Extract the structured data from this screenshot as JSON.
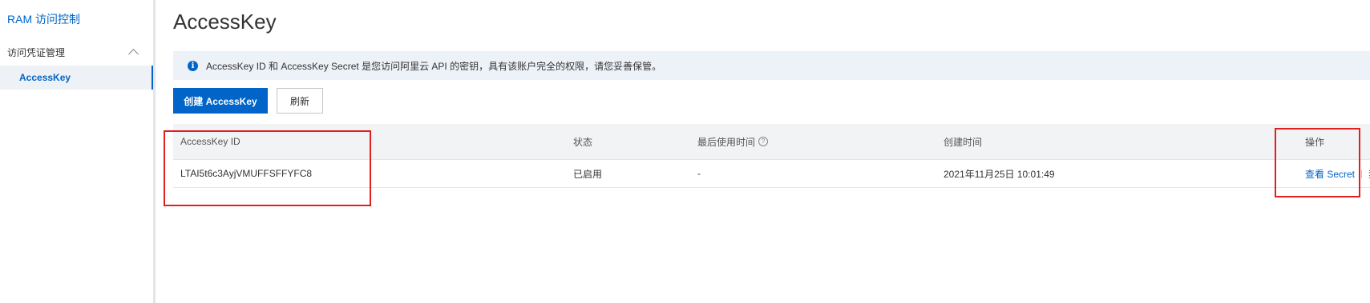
{
  "sidebar": {
    "app_title": "RAM 访问控制",
    "group_label": "访问凭证管理",
    "active_item": "AccessKey"
  },
  "page": {
    "title": "AccessKey",
    "notice": "AccessKey ID 和 AccessKey Secret 是您访问阿里云 API 的密钥，具有该账户完全的权限，请您妥善保管。",
    "notice_icon": "i"
  },
  "toolbar": {
    "create_label": "创建 AccessKey",
    "refresh_label": "刷新"
  },
  "table": {
    "columns": [
      "AccessKey ID",
      "状态",
      "最后使用时间",
      "创建时间",
      "操作"
    ],
    "help_icon": "?",
    "rows": [
      {
        "id": "LTAI5t6c3AyjVMUFFSFFYFC8",
        "status": "已启用",
        "last_used": "-",
        "created": "2021年11月25日 10:01:49",
        "action_view": "查看 Secret",
        "action_disable": "禁"
      }
    ]
  },
  "colors": {
    "accent": "#0064c8",
    "annotation": "#e02020",
    "notice_bg": "#edf2f8",
    "header_bg": "#f2f3f5"
  }
}
